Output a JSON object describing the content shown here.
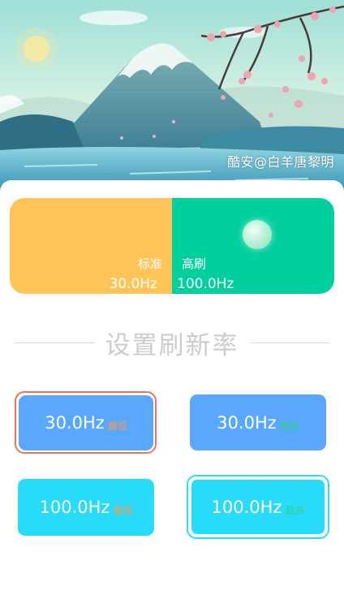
{
  "banner": {
    "watermark": "酷安@白羊唐黎明"
  },
  "status": {
    "standard_label": "标准",
    "standard_value": "30.0Hz",
    "high_label": "高刷",
    "high_value": "100.0Hz",
    "colors": {
      "standard": "#fec457",
      "high": "#00cf9e"
    }
  },
  "section": {
    "title": "设置刷新率"
  },
  "presets": [
    {
      "value": "30.0Hz",
      "tag": "最低",
      "selected": true
    },
    {
      "value": "30.0Hz",
      "tag": "最高",
      "selected": false
    },
    {
      "value": "100.0Hz",
      "tag": "最低",
      "selected": false
    },
    {
      "value": "100.0Hz",
      "tag": "最高",
      "selected": true
    }
  ],
  "colors": {
    "preset_30": "#5aa8fd",
    "preset_100": "#29dbfb",
    "ring_30": "#f0735a",
    "ring_100": "#29dbfb"
  }
}
